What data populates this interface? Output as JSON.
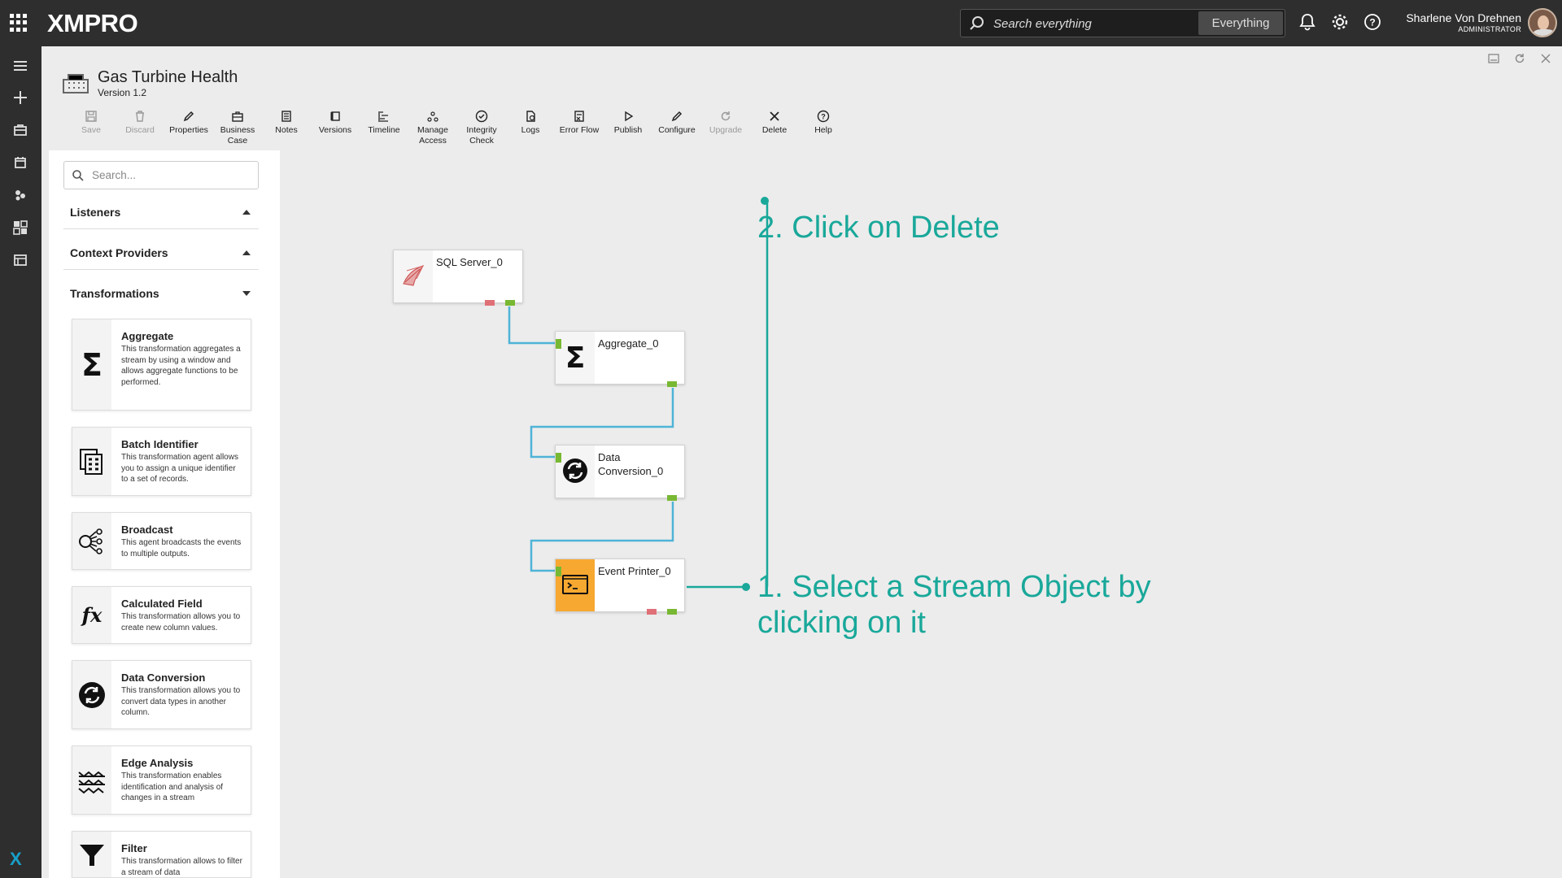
{
  "topbar": {
    "logo": "XMPRO",
    "search_placeholder": "Search everything",
    "search_scope": "Everything",
    "user_name": "Sharlene Von Drehnen",
    "user_role": "ADMINISTRATOR"
  },
  "header": {
    "title": "Gas Turbine Health",
    "version": "Version 1.2"
  },
  "toolbar": [
    {
      "label": "Save",
      "icon": "save-icon",
      "disabled": true
    },
    {
      "label": "Discard",
      "icon": "trash-icon",
      "disabled": true
    },
    {
      "label": "Properties",
      "icon": "pencil-icon",
      "disabled": false
    },
    {
      "label": "Business Case",
      "icon": "briefcase-icon",
      "disabled": false
    },
    {
      "label": "Notes",
      "icon": "notes-icon",
      "disabled": false
    },
    {
      "label": "Versions",
      "icon": "versions-icon",
      "disabled": false
    },
    {
      "label": "Timeline",
      "icon": "timeline-icon",
      "disabled": false
    },
    {
      "label": "Manage Access",
      "icon": "access-icon",
      "disabled": false
    },
    {
      "label": "Integrity Check",
      "icon": "check-circle-icon",
      "disabled": false
    },
    {
      "label": "Logs",
      "icon": "logs-icon",
      "disabled": false
    },
    {
      "label": "Error Flow",
      "icon": "error-flow-icon",
      "disabled": false
    },
    {
      "label": "Publish",
      "icon": "play-icon",
      "disabled": false
    },
    {
      "label": "Configure",
      "icon": "pencil-icon",
      "disabled": false
    },
    {
      "label": "Upgrade",
      "icon": "refresh-icon",
      "disabled": true
    },
    {
      "label": "Delete",
      "icon": "close-icon",
      "disabled": false
    },
    {
      "label": "Help",
      "icon": "help-icon",
      "disabled": false
    }
  ],
  "sidebar": {
    "search_placeholder": "Search...",
    "sections": [
      {
        "label": "Listeners",
        "expanded": false
      },
      {
        "label": "Context Providers",
        "expanded": false
      },
      {
        "label": "Transformations",
        "expanded": true
      }
    ],
    "cards": [
      {
        "name": "Aggregate",
        "desc": "This transformation aggregates a stream by using a window and allows aggregate functions to be performed.",
        "icon": "sigma-icon"
      },
      {
        "name": "Batch Identifier",
        "desc": "This transformation agent allows you to assign a unique identifier to a set of records.",
        "icon": "batch-icon"
      },
      {
        "name": "Broadcast",
        "desc": "This agent broadcasts the events to multiple outputs.",
        "icon": "broadcast-icon"
      },
      {
        "name": "Calculated Field",
        "desc": "This transformation allows you to create new column values.",
        "icon": "fx-icon"
      },
      {
        "name": "Data Conversion",
        "desc": "This transformation allows you to convert data types in another column.",
        "icon": "convert-icon"
      },
      {
        "name": "Edge Analysis",
        "desc": "This transformation enables identification and analysis of changes in a stream",
        "icon": "edge-icon"
      },
      {
        "name": "Filter",
        "desc": "This transformation allows to filter a stream of data",
        "icon": "filter-icon"
      }
    ]
  },
  "canvas": {
    "nodes": [
      {
        "label": "SQL Server_0",
        "icon": "sql-server-icon"
      },
      {
        "label": "Aggregate_0",
        "icon": "sigma-icon"
      },
      {
        "label": "Data Conversion_0",
        "icon": "convert-icon"
      },
      {
        "label": "Event Printer_0",
        "icon": "terminal-icon"
      }
    ],
    "annotations": {
      "delete": "2. Click on Delete",
      "select": "1. Select a Stream Object by clicking on it"
    }
  },
  "colors": {
    "accent": "#19a89a",
    "link": "#4fb3d8",
    "selected": "#f7a831",
    "pin_ok": "#78b832",
    "pin_err": "#e07078"
  }
}
